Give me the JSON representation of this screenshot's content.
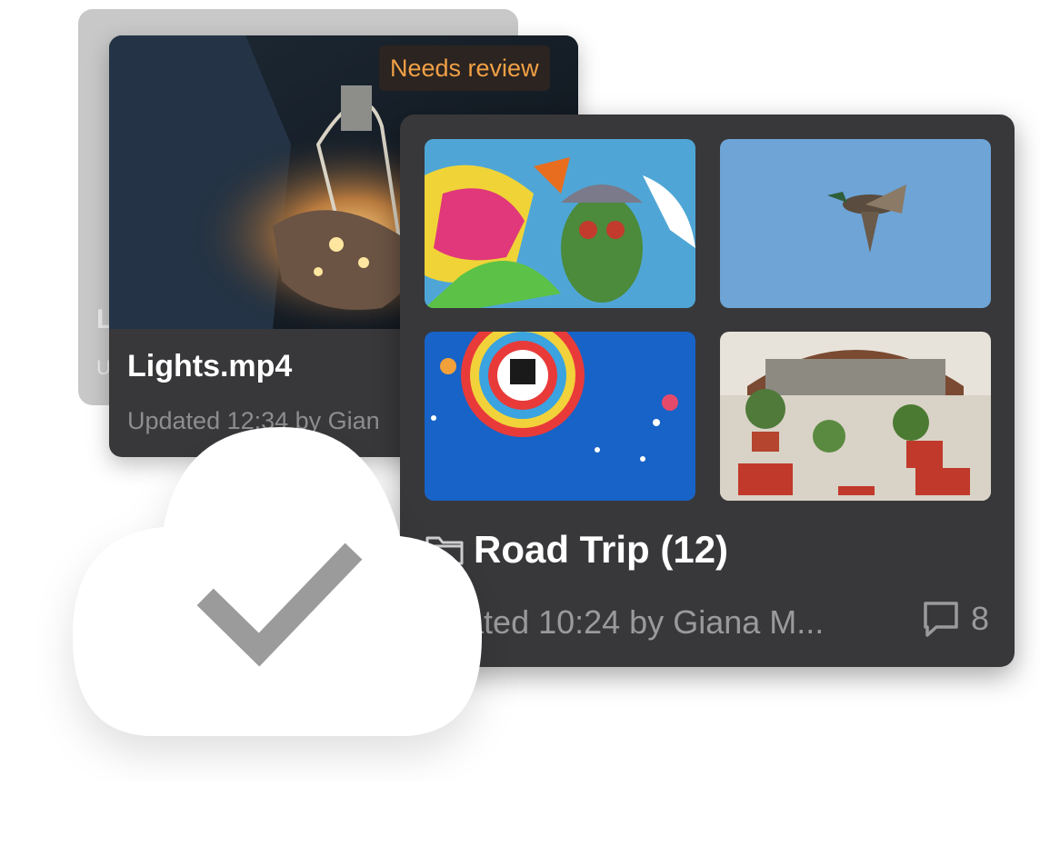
{
  "ghost_card": {
    "title_initial": "L",
    "updated_initial": "U"
  },
  "video_card": {
    "badge": "Needs review",
    "title": "Lights.mp4",
    "updated": "Updated 12:34 by Gian"
  },
  "folder_card": {
    "title": "Road Trip (12)",
    "updated": "dated 10:24 by Giana M...",
    "comment_count": "8",
    "tiles": [
      "graffiti-photo",
      "duck-photo",
      "hot-air-balloon-photo",
      "potted-plants-photo"
    ]
  },
  "cloud_badge": {
    "icon": "cloud-check-icon"
  },
  "colors": {
    "card_bg": "#38383a",
    "badge_text": "#f1a046",
    "muted_text": "#9a9a9c"
  }
}
